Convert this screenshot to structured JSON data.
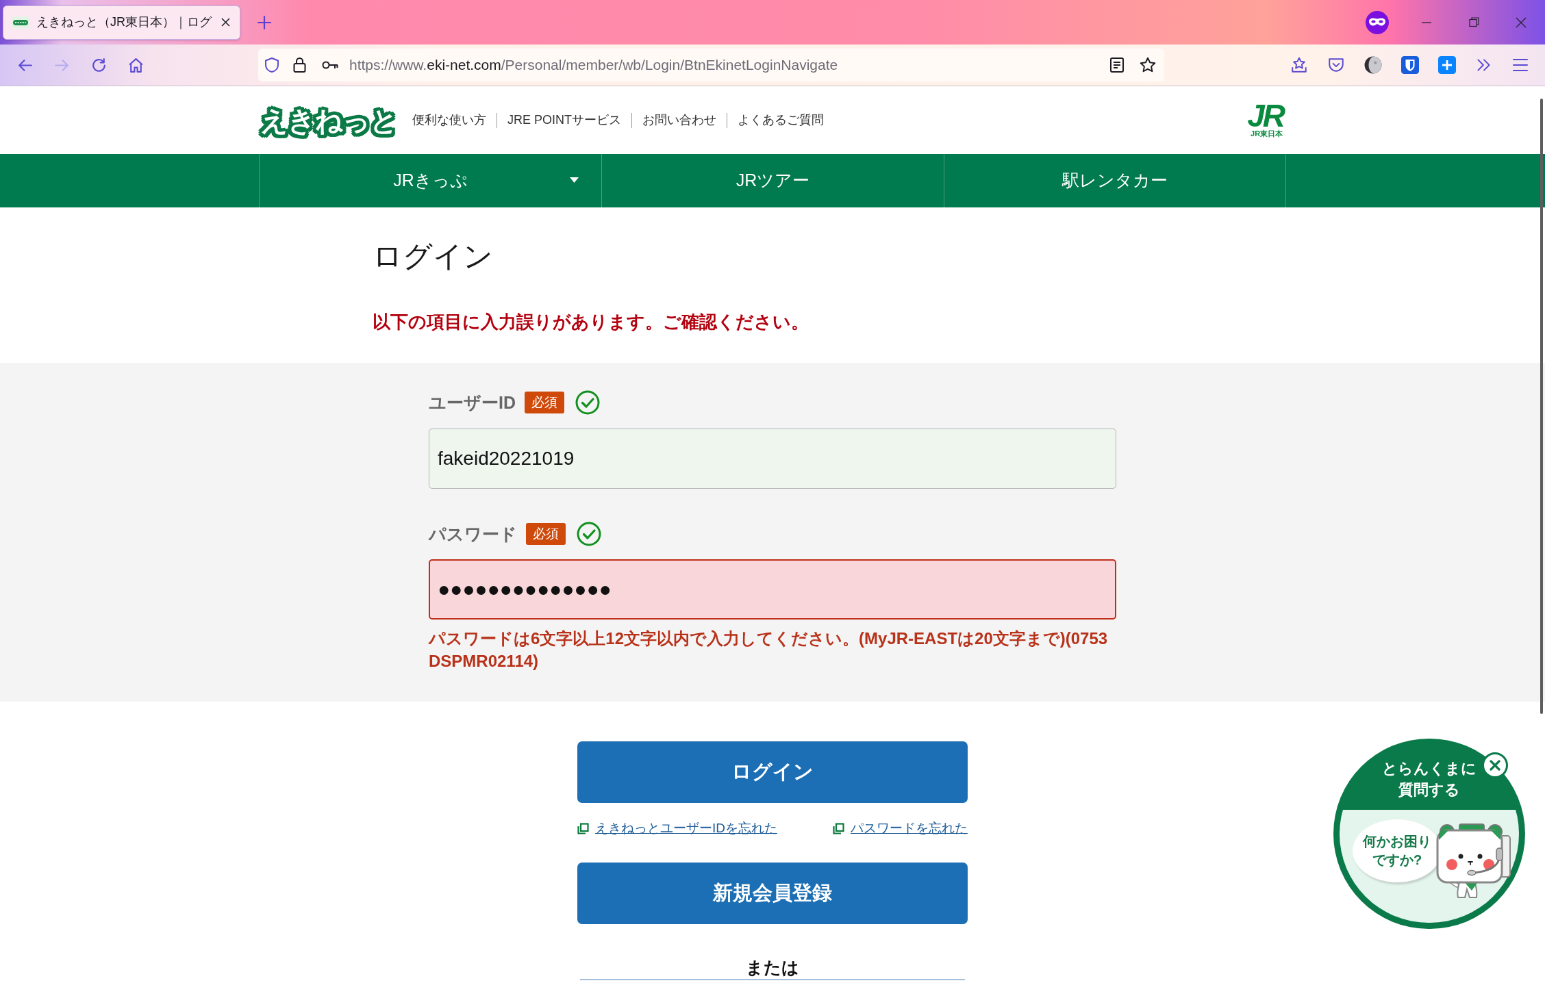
{
  "browser": {
    "tabs": [
      {
        "title": "えきねっと（JR東日本）｜ログ",
        "selected": true
      }
    ],
    "forward_disabled": true,
    "url": {
      "prefix": "https://www.",
      "domain": "eki-net.com",
      "path": "/Personal/member/wb/Login/BtnEkinetLoginNavigate"
    }
  },
  "header": {
    "logo": "えきねっと",
    "links": [
      "便利な使い方",
      "JRE POINTサービス",
      "お問い合わせ",
      "よくあるご質問"
    ],
    "brand": {
      "mark": "JR",
      "caption": "JR東日本"
    }
  },
  "nav": [
    {
      "label": "JRきっぷ",
      "kind": "dropdown"
    },
    {
      "label": "JRツアー",
      "kind": "link"
    },
    {
      "label": "駅レンタカー",
      "kind": "link"
    }
  ],
  "login": {
    "title": "ログイン",
    "error_summary": "以下の項目に入力誤りがあります。ご確認ください。",
    "fields": [
      {
        "label": "ユーザーID",
        "badge": "必須",
        "confirmed": true,
        "value": "fakeid20221019",
        "error": false
      },
      {
        "label": "パスワード",
        "badge": "必須",
        "confirmed": true,
        "value": "●●●●●●●●●●●●●●",
        "error": true,
        "message": "パスワードは6文字以上12文字以内で入力してください。(MyJR-EASTは20文字まで)(0753DSPMR02114)"
      }
    ],
    "submit": "ログイン",
    "links": [
      "えきねっとユーザーIDを忘れた",
      "パスワードを忘れた"
    ],
    "register": "新規会員登録",
    "separator": "または"
  },
  "chat_widget": {
    "title_lines": [
      "とらんくまに",
      "質問する"
    ],
    "bubble_lines": [
      "何かお困り",
      "ですか?"
    ]
  }
}
